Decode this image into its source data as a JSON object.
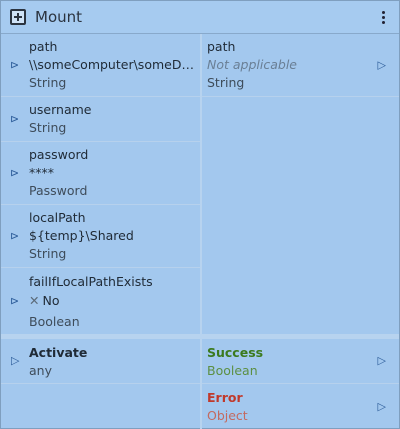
{
  "header": {
    "title": "Mount",
    "icon": "add-node-icon",
    "menu_icon": "kebab-menu-icon"
  },
  "inputs": [
    {
      "name": "path",
      "value": "\\\\someComputer\\someDi...",
      "type": "String"
    },
    {
      "name": "username",
      "type": "String"
    },
    {
      "name": "password",
      "value": "****",
      "type": "Password"
    },
    {
      "name": "localPath",
      "value": "${temp}\\Shared",
      "type": "String"
    },
    {
      "name": "failIfLocalPathExists",
      "value": "No",
      "type": "Boolean"
    }
  ],
  "output": {
    "name": "path",
    "value": "Not applicable",
    "type": "String"
  },
  "trigger": {
    "name": "Activate",
    "type": "any"
  },
  "results": [
    {
      "name": "Success",
      "type": "Boolean",
      "color": "#3b7a1e"
    },
    {
      "name": "Error",
      "type": "Object",
      "color": "#c0392b"
    }
  ],
  "colors": {
    "background": "#a3c8ee",
    "arrow": "#2d5d9a"
  }
}
